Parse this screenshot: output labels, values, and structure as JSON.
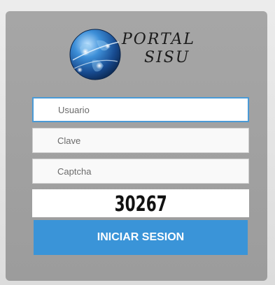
{
  "logo": {
    "line1": "PORTAL",
    "line2": "SISU",
    "icon": "globe-icon"
  },
  "form": {
    "username_placeholder": "Usuario",
    "password_placeholder": "Clave",
    "captcha_placeholder": "Captcha",
    "captcha_code": "30267",
    "submit_label": "INICIAR SESION"
  },
  "colors": {
    "accent": "#3a94d8",
    "focus_border": "#4a9ad6",
    "panel": "#a3a3a3"
  }
}
